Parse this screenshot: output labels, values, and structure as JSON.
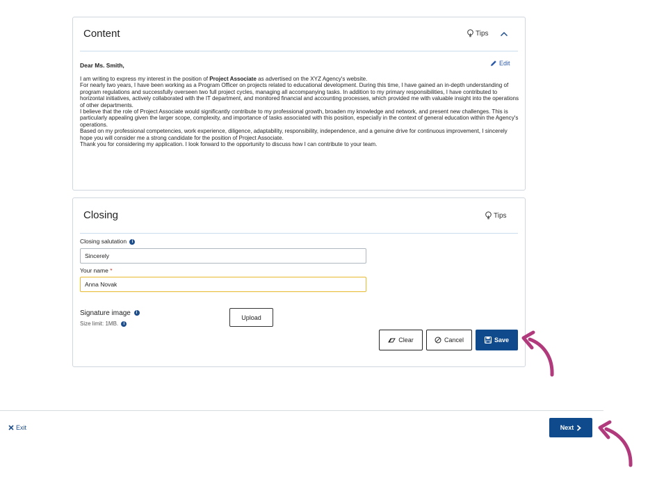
{
  "content_panel": {
    "title": "Content",
    "tips_label": "Tips",
    "salutation": "Dear Ms. Smith,",
    "edit_label": "Edit",
    "paragraph1_pre": "I am writing to express my interest in the position of ",
    "paragraph1_bold": "Project Associate",
    "paragraph1_post": " as advertised on the XYZ Agency's website.",
    "paragraph2": "For nearly two years, I have been working as a Program Officer on projects related to educational development. During this time, I have gained an in-depth understanding of program regulations and successfully overseen two full project cycles, managing all accompanying tasks. In addition to my primary responsibilities, I have contributed to horizontal initiatives, actively collaborated with the IT department, and monitored financial and accounting processes, which provided me with valuable insight into the operations of other departments.",
    "paragraph3": "I believe that the role of Project Associate would significantly contribute to my professional growth, broaden my knowledge and network, and present new challenges. This is particularly appealing given the larger scope, complexity, and importance of tasks associated with this position, especially in the context of general education within the Agency's operations.",
    "paragraph4": "Based on my professional competencies, work experience, diligence, adaptability, responsibility, independence, and a genuine drive for continuous improvement, I sincerely hope you will consider me a strong candidate for the position of Project Associate.",
    "paragraph5": "Thank you for considering my application. I look forward to the opportunity to discuss how I can contribute to your team."
  },
  "closing_panel": {
    "title": "Closing",
    "tips_label": "Tips",
    "closing_salutation_label": "Closing salutation",
    "closing_salutation_value": "Sincerely",
    "your_name_label": "Your name",
    "required_marker": "*",
    "your_name_value": "Anna Novak",
    "signature_label": "Signature image",
    "size_limit_label": "Size limit: 1MB.",
    "upload_label": "Upload",
    "clear_label": "Clear",
    "cancel_label": "Cancel",
    "save_label": "Save"
  },
  "footer": {
    "exit_label": "Exit",
    "next_label": "Next"
  },
  "colors": {
    "primary": "#0f4a8c",
    "arrow": "#b03a7c",
    "focus_border": "#e8b92a",
    "divider": "#c8dcee"
  }
}
